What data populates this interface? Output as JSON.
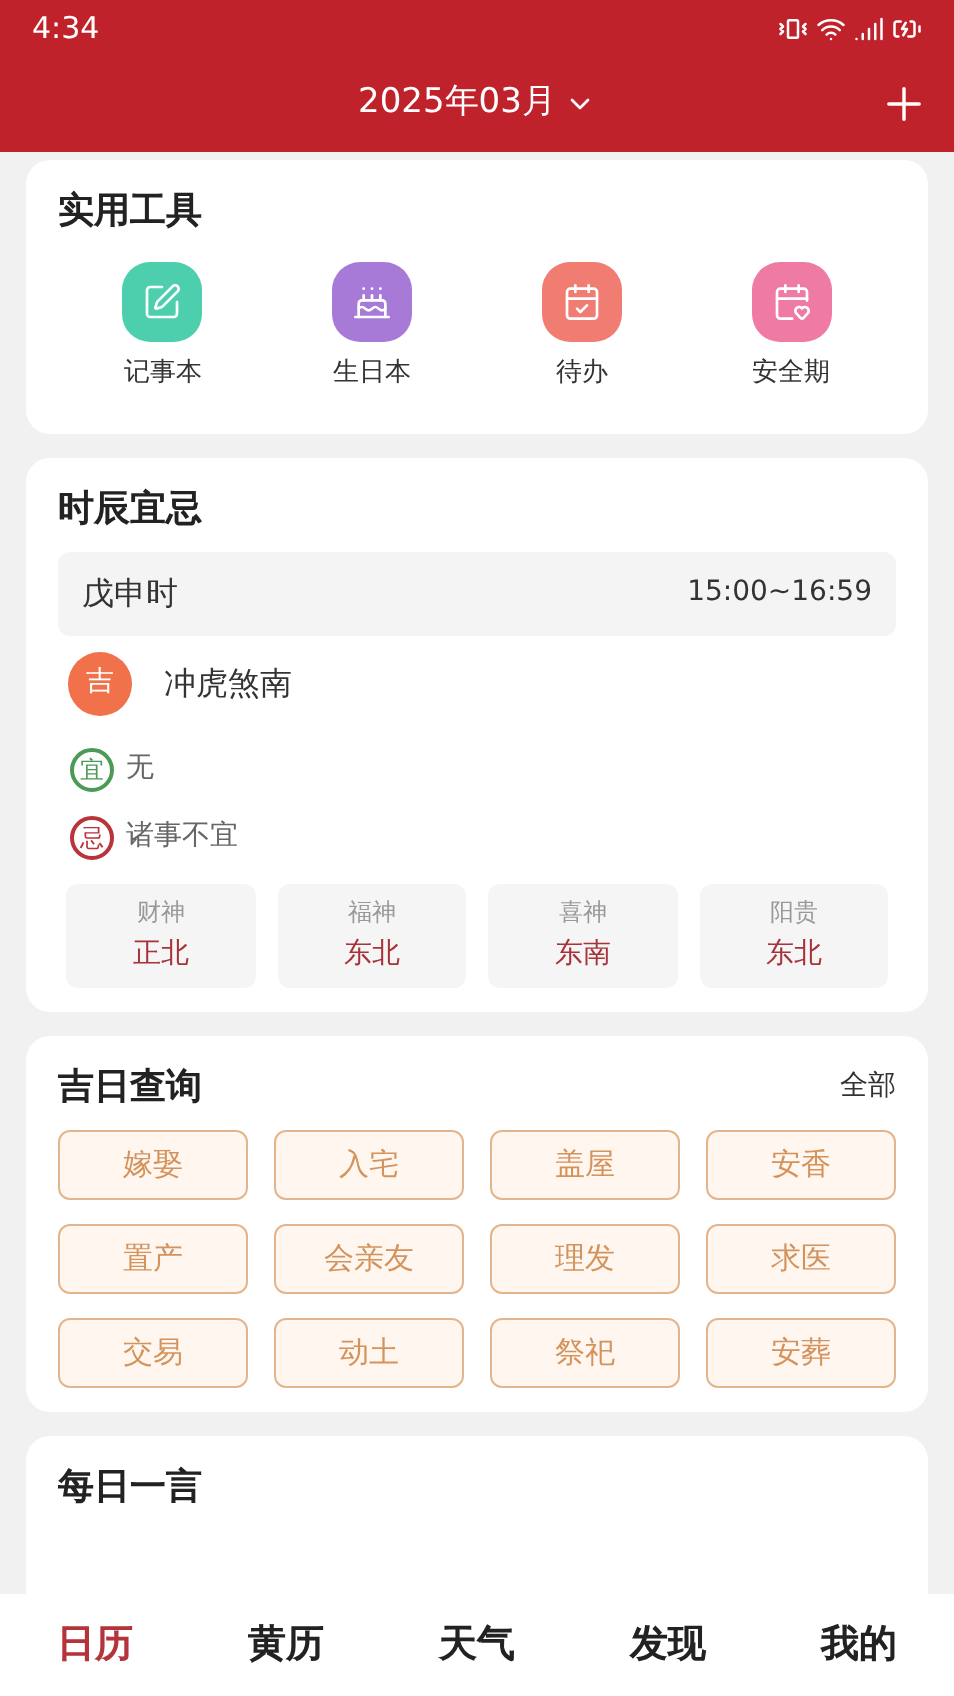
{
  "status_bar": {
    "time": "4:34"
  },
  "header": {
    "title": "2025年03月"
  },
  "tools": {
    "title": "实用工具",
    "items": [
      {
        "label": "记事本",
        "color": "#4dcfae",
        "kind": "note"
      },
      {
        "label": "生日本",
        "color": "#a87ad8",
        "kind": "cake"
      },
      {
        "label": "待办",
        "color": "#f07c72",
        "kind": "todo"
      },
      {
        "label": "安全期",
        "color": "#ef7aa4",
        "kind": "heart"
      }
    ]
  },
  "shichen": {
    "title": "时辰宜忌",
    "period": {
      "name": "戊申时",
      "time": "15:00~16:59"
    },
    "clash": {
      "badge": "吉",
      "text": "冲虎煞南"
    },
    "yi": {
      "badge": "宜",
      "text": "无"
    },
    "ji": {
      "badge": "忌",
      "text": "诸事不宜"
    },
    "gods": [
      {
        "label": "财神",
        "direction": "正北"
      },
      {
        "label": "福神",
        "direction": "东北"
      },
      {
        "label": "喜神",
        "direction": "东南"
      },
      {
        "label": "阳贵",
        "direction": "东北"
      }
    ]
  },
  "jiri": {
    "title": "吉日查询",
    "more": "全部",
    "tags": [
      "嫁娶",
      "入宅",
      "盖屋",
      "安香",
      "置产",
      "会亲友",
      "理发",
      "求医",
      "交易",
      "动土",
      "祭祀",
      "安葬"
    ]
  },
  "daily": {
    "title": "每日一言"
  },
  "nav": [
    {
      "label": "日历",
      "selected": true
    },
    {
      "label": "黄历",
      "selected": false
    },
    {
      "label": "天气",
      "selected": false
    },
    {
      "label": "发现",
      "selected": false
    },
    {
      "label": "我的",
      "selected": false
    }
  ]
}
